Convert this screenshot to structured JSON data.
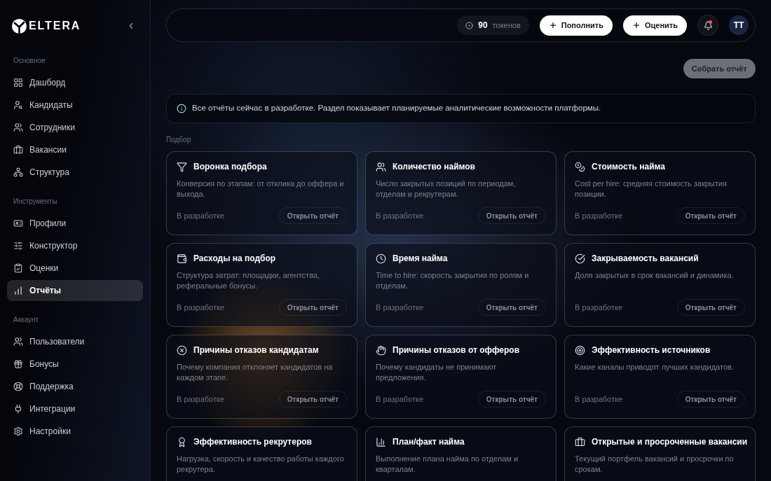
{
  "sidebar": {
    "logo": {
      "text": "ELTERA"
    },
    "sections": [
      {
        "title": "Основное",
        "items": [
          {
            "label": "Дашборд",
            "selected": false
          },
          {
            "label": "Кандидаты",
            "selected": false
          },
          {
            "label": "Сотрудники",
            "selected": false
          },
          {
            "label": "Вакансии",
            "selected": false
          },
          {
            "label": "Структура",
            "selected": false
          }
        ]
      },
      {
        "title": "Инструменты",
        "items": [
          {
            "label": "Профили",
            "selected": false
          },
          {
            "label": "Конструктор",
            "selected": false
          },
          {
            "label": "Оценки",
            "selected": false
          },
          {
            "label": "Отчёты",
            "selected": true
          }
        ]
      },
      {
        "title": "Аккаунт",
        "items": [
          {
            "label": "Пользователи",
            "selected": false
          },
          {
            "label": "Бонусы",
            "selected": false
          },
          {
            "label": "Поддержка",
            "selected": false
          },
          {
            "label": "Интеграции",
            "selected": false
          },
          {
            "label": "Настройки",
            "selected": false
          }
        ]
      }
    ]
  },
  "top_bar": {
    "tokens": {
      "value": "90",
      "unit": "токенов"
    },
    "buttons": [
      {
        "label": "Пополнить"
      },
      {
        "label": "Оценить"
      }
    ],
    "notifications": {
      "unread": true
    },
    "avatar": {
      "initials": "ТТ"
    }
  },
  "toolbar": {
    "build_report_button": {
      "label": "Собрать отчёт",
      "disabled": true
    }
  },
  "notice": {
    "text": "Все отчёты сейчас в разработке. Раздел показывает планируемые аналитические возможности платформы."
  },
  "sections": [
    {
      "title": "Подбор",
      "cards": [
        {
          "title": "Воронка подбора",
          "description": "Конверсия по этапам: от отклика до оффера и выхода.",
          "status": "В разработке",
          "open_button": {
            "label": "Открыть отчёт",
            "disabled": true
          }
        },
        {
          "title": "Количество наймов",
          "description": "Число закрытых позиций по периодам, отделам и рекрутерам.",
          "status": "В разработке",
          "open_button": {
            "label": "Открыть отчёт",
            "disabled": true
          }
        },
        {
          "title": "Стоимость найма",
          "description": "Cost per hire: средняя стоимость закрытия позиции.",
          "status": "В разработке",
          "open_button": {
            "label": "Открыть отчёт",
            "disabled": true
          }
        },
        {
          "title": "Расходы на подбор",
          "description": "Структура затрат: площадки, агентства, реферальные бонусы.",
          "status": "В разработке",
          "open_button": {
            "label": "Открыть отчёт",
            "disabled": true
          }
        },
        {
          "title": "Время найма",
          "description": "Time to hire: скорость закрытия по ролям и отделам.",
          "status": "В разработке",
          "open_button": {
            "label": "Открыть отчёт",
            "disabled": true
          }
        },
        {
          "title": "Закрываемость вакансий",
          "description": "Доля закрытых в срок вакансий и динамика.",
          "status": "В разработке",
          "open_button": {
            "label": "Открыть отчёт",
            "disabled": true
          }
        },
        {
          "title": "Причины отказов кандидатам",
          "description": "Почему компания отклоняет кандидатов на каждом этапе.",
          "status": "В разработке",
          "open_button": {
            "label": "Открыть отчёт",
            "disabled": true
          }
        },
        {
          "title": "Причины отказов от офферов",
          "description": "Почему кандидаты не принимают предложения.",
          "status": "В разработке",
          "open_button": {
            "label": "Открыть отчёт",
            "disabled": true
          }
        },
        {
          "title": "Эффективность источников",
          "description": "Какие каналы приводят лучших кандидатов.",
          "status": "В разработке",
          "open_button": {
            "label": "Открыть отчёт",
            "disabled": true
          }
        },
        {
          "title": "Эффективность рекрутеров",
          "description": "Нагрузка, скорость и качество работы каждого рекрутера."
        },
        {
          "title": "План/факт найма",
          "description": "Выполнение плана найма по отделам и кварталам."
        },
        {
          "title": "Открытые и просроченные вакансии",
          "description": "Текущий портфель вакансий и просрочки по срокам."
        }
      ]
    }
  ]
}
